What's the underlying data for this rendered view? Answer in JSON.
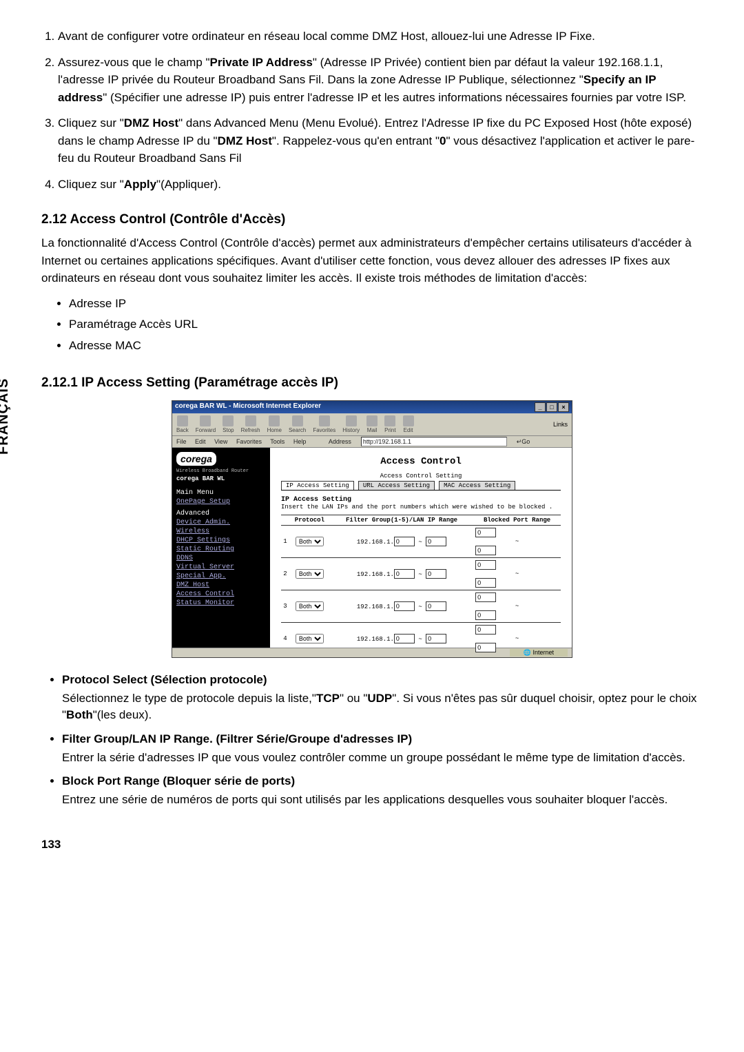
{
  "vertical_label": "FRANÇAIS",
  "page_number": "133",
  "list_items": {
    "1": "Avant de configurer votre ordinateur en réseau local comme DMZ Host, allouez-lui une Adresse IP Fixe.",
    "2_pre": "Assurez-vous que le champ \"",
    "2_b1": "Private IP Address",
    "2_mid": "\" (Adresse IP Privée) contient bien par défaut la valeur 192.168.1.1, l'adresse IP privée du Routeur Broadband Sans Fil. Dans la zone Adresse IP Publique, sélectionnez \"",
    "2_b2": "Specify an IP address",
    "2_post": "\" (Spécifier une adresse IP) puis entrer l'adresse IP et les autres informations nécessaires fournies par votre ISP.",
    "3_pre": "Cliquez sur \"",
    "3_b1": "DMZ Host",
    "3_mid1": "\" dans Advanced Menu (Menu Evolué). Entrez l'Adresse IP fixe du PC Exposed Host (hôte exposé) dans le champ Adresse IP du \"",
    "3_b2": "DMZ Host",
    "3_mid2": "\". Rappelez-vous qu'en entrant  \"",
    "3_b3": "0",
    "3_post": "\" vous désactivez l'application et activer le pare-feu du Routeur Broadband Sans Fil",
    "4_pre": "Cliquez sur \"",
    "4_b1": "Apply",
    "4_post": "\"(Appliquer)."
  },
  "heading_212": "2.12 Access Control (Contrôle d'Accès)",
  "para_212": "La fonctionnalité d'Access Control (Contrôle d'accès) permet aux administrateurs d'empêcher certains utilisateurs d'accéder à Internet ou certaines applications spécifiques. Avant d'utiliser cette fonction, vous devez allouer des adresses IP fixes aux ordinateurs en réseau dont vous souhaitez limiter les accès. Il existe trois méthodes de limitation d'accès:",
  "bullets_212": [
    "Adresse IP",
    "Paramétrage Accès URL",
    "Adresse MAC"
  ],
  "heading_2121": "2.12.1 IP Access Setting (Paramétrage accès IP)",
  "ie": {
    "title": "corega BAR WL - Microsoft Internet Explorer",
    "toolbar": [
      "Back",
      "Forward",
      "Stop",
      "Refresh",
      "Home",
      "Search",
      "Favorites",
      "History",
      "Mail",
      "Print",
      "Edit"
    ],
    "links_label": "Links",
    "menu": [
      "File",
      "Edit",
      "View",
      "Favorites",
      "Tools",
      "Help"
    ],
    "address_label": "Address",
    "address_value": "http://192.168.1.1",
    "go_label": "Go",
    "sidebar": {
      "logo": "corega",
      "subtitle": "Wireless Broadband Router",
      "model": "corega BAR WL",
      "main_menu_hdr": "Main Menu",
      "onepage": "OnePage Setup",
      "advanced_hdr": "Advanced",
      "items": [
        "Device Admin.",
        "Wireless",
        "DHCP Settings",
        "Static Routing",
        "DDNS",
        "Virtual Server",
        "Special App.",
        "DMZ Host",
        "Access Control",
        "Status Monitor"
      ]
    },
    "main": {
      "title": "Access Control",
      "acs_label": "Access Control Setting",
      "tabs": [
        "IP Access Setting",
        "URL Access Setting",
        "MAC Access Setting"
      ],
      "section_label": "IP Access Setting",
      "section_desc": "Insert the LAN IPs and the port numbers which were wished to be blocked .",
      "cols": {
        "protocol": "Protocol",
        "filter": "Filter Group(1-5)/LAN IP Range",
        "blocked": "Blocked Port Range"
      },
      "ip_prefix": "192.168.1.",
      "rows": [
        1,
        2,
        3,
        4
      ],
      "protocol_option": "Both",
      "default_val": "0",
      "tilde": "~"
    },
    "status_zone": "Internet"
  },
  "desc": {
    "protocol_title": "Protocol Select (Sélection protocole)",
    "protocol_pre": "Sélectionnez le type de protocole depuis la liste,\"",
    "protocol_b1": "TCP",
    "protocol_mid": "\" ou \"",
    "protocol_b2": "UDP",
    "protocol_mid2": "\". Si vous n'êtes pas sûr duquel choisir, optez pour le choix \"",
    "protocol_b3": "Both",
    "protocol_post": "\"(les deux).",
    "filter_title": "Filter Group/LAN IP Range. (Filtrer Série/Groupe d'adresses IP)",
    "filter_body": "Entrer la série d'adresses IP que vous voulez  contrôler comme un groupe possédant le même type de limitation d'accès.",
    "block_title": "Block Port Range (Bloquer série de ports)",
    "block_body": "Entrez une série de numéros de ports qui sont utilisés par les applications desquelles vous souhaiter bloquer l'accès."
  }
}
